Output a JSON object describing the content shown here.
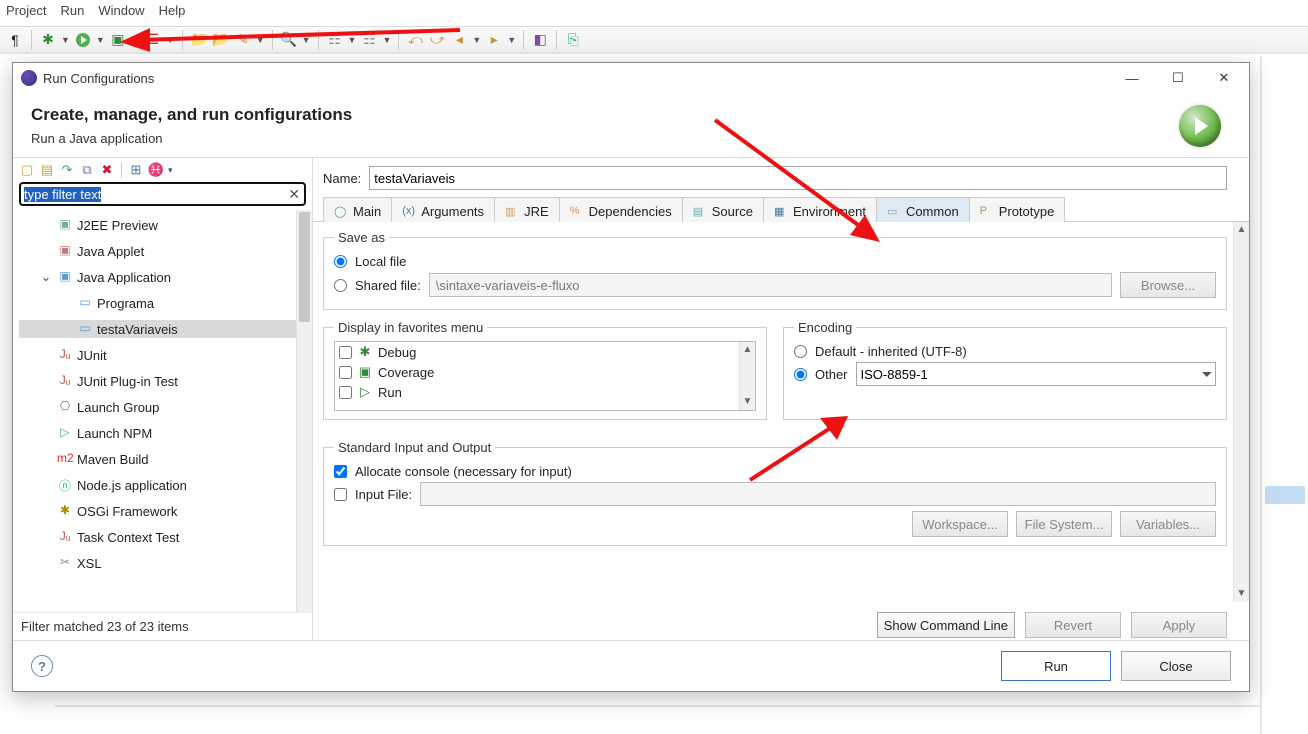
{
  "menubar": [
    "Project",
    "Run",
    "Window",
    "Help"
  ],
  "dialog": {
    "title": "Run Configurations",
    "banner_heading": "Create, manage, and run configurations",
    "banner_sub": "Run a Java application"
  },
  "left": {
    "filter_value": "type filter text",
    "items": [
      {
        "label": "J2EE Preview",
        "indent": 1
      },
      {
        "label": "Java Applet",
        "indent": 1
      },
      {
        "label": "Java Application",
        "indent": 1,
        "expanded": true
      },
      {
        "label": "Programa",
        "indent": 2
      },
      {
        "label": "testaVariaveis",
        "indent": 2,
        "selected": true
      },
      {
        "label": "JUnit",
        "indent": 1
      },
      {
        "label": "JUnit Plug-in Test",
        "indent": 1
      },
      {
        "label": "Launch Group",
        "indent": 1
      },
      {
        "label": "Launch NPM",
        "indent": 1
      },
      {
        "label": "Maven Build",
        "indent": 1
      },
      {
        "label": "Node.js application",
        "indent": 1
      },
      {
        "label": "OSGi Framework",
        "indent": 1
      },
      {
        "label": "Task Context Test",
        "indent": 1
      },
      {
        "label": "XSL",
        "indent": 1
      }
    ],
    "footer": "Filter matched 23 of 23 items"
  },
  "right": {
    "name_label": "Name:",
    "name_value": "testaVariaveis",
    "tabs": [
      "Main",
      "Arguments",
      "JRE",
      "Dependencies",
      "Source",
      "Environment",
      "Common",
      "Prototype"
    ],
    "active_tab": "Common",
    "save_as": {
      "legend": "Save as",
      "local": "Local file",
      "shared": "Shared file:",
      "shared_value": "\\sintaxe-variaveis-e-fluxo",
      "browse": "Browse..."
    },
    "favorites": {
      "legend": "Display in favorites menu",
      "items": [
        "Debug",
        "Coverage",
        "Run"
      ]
    },
    "encoding": {
      "legend": "Encoding",
      "default_label": "Default - inherited (UTF-8)",
      "other_label": "Other",
      "other_value": "ISO-8859-1"
    },
    "stdio": {
      "legend": "Standard Input and Output",
      "allocate": "Allocate console (necessary for input)",
      "inputfile": "Input File:",
      "workspace": "Workspace...",
      "filesystem": "File System...",
      "variables": "Variables..."
    },
    "actions": {
      "showcmd": "Show Command Line",
      "revert": "Revert",
      "apply": "Apply"
    }
  },
  "footer": {
    "run": "Run",
    "close": "Close"
  }
}
